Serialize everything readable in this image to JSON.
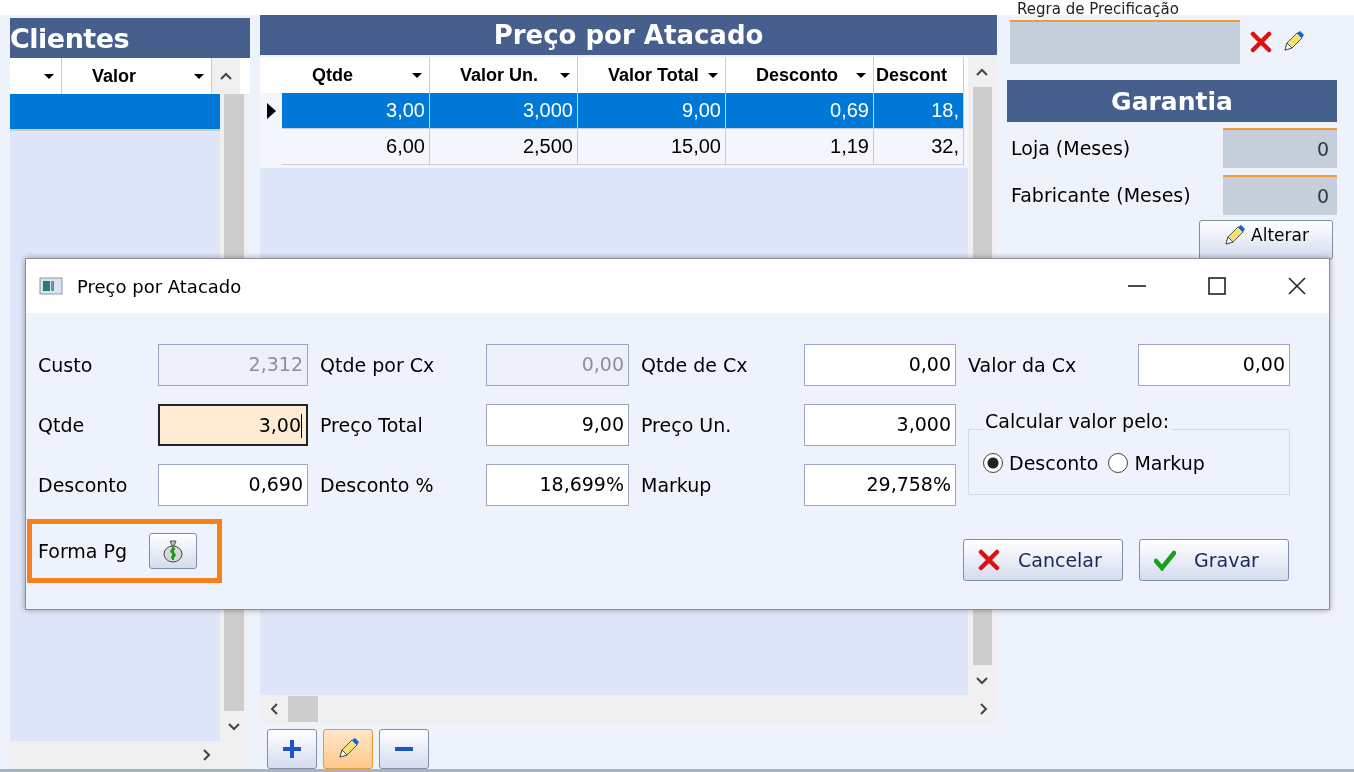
{
  "clients_panel": {
    "title": "Clientes",
    "columns": [
      "Valor"
    ],
    "rows": [
      {
        "selected": true
      }
    ]
  },
  "wholesale_panel": {
    "title": "Preço por Atacado",
    "columns": [
      "Qtde",
      "Valor Un.",
      "Valor Total",
      "Desconto",
      "Descont"
    ],
    "rows": [
      {
        "selected": true,
        "cells": [
          "3,00",
          "3,000",
          "9,00",
          "0,69",
          "18,"
        ]
      },
      {
        "selected": false,
        "cells": [
          "6,00",
          "2,500",
          "15,00",
          "1,19",
          "32,"
        ]
      }
    ],
    "toolbar": [
      {
        "kind": "add",
        "selected": false
      },
      {
        "kind": "edit",
        "selected": true
      },
      {
        "kind": "remove",
        "selected": false
      }
    ]
  },
  "pricing_rule": {
    "label": "Regra de Precificação"
  },
  "warranty": {
    "title": "Garantia",
    "fields": [
      {
        "label": "Loja (Meses)",
        "value": "0"
      },
      {
        "label": "Fabricante (Meses)",
        "value": "0"
      }
    ],
    "button": "Alterar"
  },
  "dialog": {
    "title": "Preço por Atacado",
    "fields": [
      {
        "label": "Custo",
        "value": "2,312",
        "disabled": true,
        "focused": false
      },
      {
        "label": "Qtde por Cx",
        "value": "0,00",
        "disabled": true,
        "focused": false
      },
      {
        "label": "Qtde de Cx",
        "value": "0,00",
        "disabled": false,
        "focused": false
      },
      {
        "label": "Valor da Cx",
        "value": "0,00",
        "disabled": false,
        "focused": false
      },
      {
        "label": "Qtde",
        "value": "3,00",
        "disabled": false,
        "focused": true
      },
      {
        "label": "Preço Total",
        "value": "9,00",
        "disabled": false,
        "focused": false
      },
      {
        "label": "Preço Un.",
        "value": "3,000",
        "disabled": false,
        "focused": false
      },
      {
        "label": "Desconto",
        "value": "0,690",
        "disabled": false,
        "focused": false
      },
      {
        "label": "Desconto %",
        "value": "18,699%",
        "disabled": false,
        "focused": false
      },
      {
        "label": "Markup",
        "value": "29,758%",
        "disabled": false,
        "focused": false
      }
    ],
    "calc_group": {
      "title": "Calcular valor pelo:",
      "options": [
        {
          "label": "Desconto",
          "selected": true
        },
        {
          "label": "Markup",
          "selected": false
        }
      ]
    },
    "payment": {
      "label": "Forma Pg"
    },
    "buttons": [
      {
        "kind": "cancel",
        "label": "Cancelar"
      },
      {
        "kind": "save",
        "label": "Gravar"
      }
    ]
  }
}
